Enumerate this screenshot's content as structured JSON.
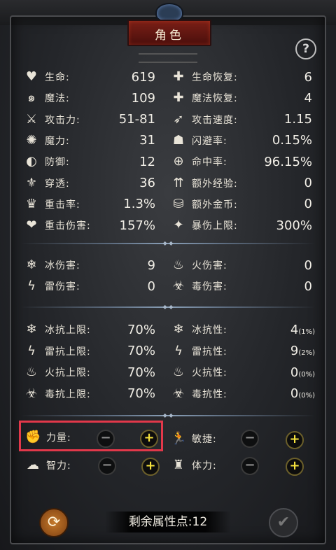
{
  "header": {
    "title": "角色",
    "help_symbol": "?"
  },
  "stats_primary": {
    "left": [
      {
        "icon": "heart-icon",
        "glyph": "♥",
        "label": "生命:",
        "value": "619"
      },
      {
        "icon": "magic-swirl-icon",
        "glyph": "๑",
        "label": "魔法:",
        "value": "109"
      },
      {
        "icon": "sword-attack-icon",
        "glyph": "⚔",
        "label": "攻击力:",
        "value": "51-81"
      },
      {
        "icon": "magic-power-icon",
        "glyph": "✺",
        "label": "魔力:",
        "value": "31"
      },
      {
        "icon": "shield-icon",
        "glyph": "◐",
        "label": "防御:",
        "value": "12"
      },
      {
        "icon": "penetration-icon",
        "glyph": "⚜",
        "label": "穿透:",
        "value": "36"
      },
      {
        "icon": "critical-rate-icon",
        "glyph": "♛",
        "label": "重击率:",
        "value": "1.3%"
      },
      {
        "icon": "critical-damage-icon",
        "glyph": "❤",
        "label": "重击伤害:",
        "value": "157%"
      }
    ],
    "right": [
      {
        "icon": "hp-regen-icon",
        "glyph": "✚",
        "label": "生命恢复:",
        "value": "6"
      },
      {
        "icon": "mp-regen-icon",
        "glyph": "✚",
        "label": "魔法恢复:",
        "value": "4"
      },
      {
        "icon": "attack-speed-icon",
        "glyph": "➶",
        "label": "攻击速度:",
        "value": "1.15"
      },
      {
        "icon": "dodge-icon",
        "glyph": "☗",
        "label": "闪避率:",
        "value": "0.15%"
      },
      {
        "icon": "crosshair-icon",
        "glyph": "⊕",
        "label": "命中率:",
        "value": "96.15%"
      },
      {
        "icon": "extra-exp-icon",
        "glyph": "⇈",
        "label": "额外经验:",
        "value": "0"
      },
      {
        "icon": "extra-gold-icon",
        "glyph": "⛁",
        "label": "额外金币:",
        "value": "0"
      },
      {
        "icon": "crit-cap-icon",
        "glyph": "✦",
        "label": "暴伤上限:",
        "value": "300%"
      }
    ]
  },
  "stats_elemental": {
    "left": [
      {
        "icon": "ice-icon",
        "glyph": "❄",
        "label": "冰伤害:",
        "value": "9"
      },
      {
        "icon": "lightning-icon",
        "glyph": "ϟ",
        "label": "雷伤害:",
        "value": "0"
      }
    ],
    "right": [
      {
        "icon": "fire-icon",
        "glyph": "♨",
        "label": "火伤害:",
        "value": "0"
      },
      {
        "icon": "poison-icon",
        "glyph": "☣",
        "label": "毒伤害:",
        "value": "0"
      }
    ]
  },
  "stats_resist": {
    "left": [
      {
        "icon": "ice-resist-cap-icon",
        "glyph": "❄",
        "label": "冰抗上限:",
        "value": "70%"
      },
      {
        "icon": "lightning-resist-cap-icon",
        "glyph": "ϟ",
        "label": "雷抗上限:",
        "value": "70%"
      },
      {
        "icon": "fire-resist-cap-icon",
        "glyph": "♨",
        "label": "火抗上限:",
        "value": "70%"
      },
      {
        "icon": "poison-resist-cap-icon",
        "glyph": "☣",
        "label": "毒抗上限:",
        "value": "70%"
      }
    ],
    "right": [
      {
        "icon": "ice-resist-icon",
        "glyph": "❄",
        "label": "冰抗性:",
        "value": "4",
        "sub": "(1%)"
      },
      {
        "icon": "lightning-resist-icon",
        "glyph": "ϟ",
        "label": "雷抗性:",
        "value": "9",
        "sub": "(2%)"
      },
      {
        "icon": "fire-resist-icon",
        "glyph": "♨",
        "label": "火抗性:",
        "value": "0",
        "sub": "(0%)"
      },
      {
        "icon": "poison-resist-icon",
        "glyph": "☣",
        "label": "毒抗性:",
        "value": "0",
        "sub": "(0%)"
      }
    ]
  },
  "attributes": {
    "strength": {
      "label": "力量:",
      "glyph": "✊"
    },
    "agility": {
      "label": "敏捷:",
      "glyph": "🏃"
    },
    "intellect": {
      "label": "智力:",
      "glyph": "☁"
    },
    "stamina": {
      "label": "体力:",
      "glyph": "♜"
    },
    "minus": "−",
    "plus": "+"
  },
  "footer": {
    "remaining_points": "剩余属性点:12",
    "reset_glyph": "⟳",
    "confirm_glyph": "✔"
  }
}
